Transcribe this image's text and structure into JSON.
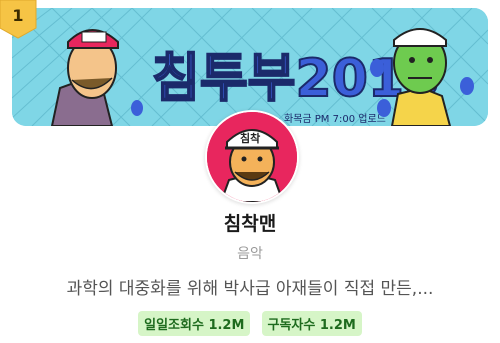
{
  "rank": "1",
  "banner": {
    "title_art": "침투부2015",
    "schedule": "화목금 PM 7:00 업로드"
  },
  "channel": {
    "name": "침착맨",
    "category": "음악",
    "description": "과학의 대중화를 위해 박사급 아재들이 직접 만든,...",
    "avatar_hat_text": "침착"
  },
  "stats": [
    {
      "label": "일일조회수 1.2M"
    },
    {
      "label": "구독자수 1.2M"
    }
  ],
  "colors": {
    "stat_bg": "#d6f5c7",
    "stat_text": "#1e6b1e",
    "avatar_bg": "#e8265e",
    "rank_badge": "#f6c445"
  }
}
